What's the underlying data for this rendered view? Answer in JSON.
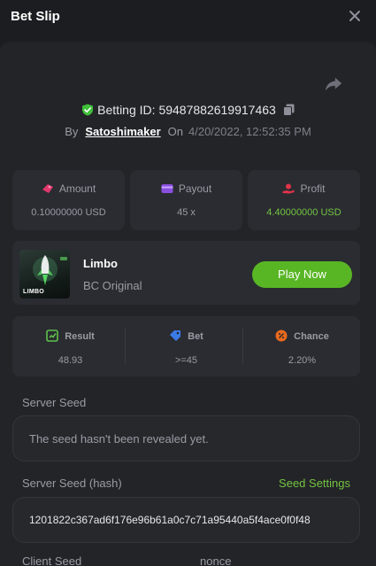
{
  "header": {
    "title": "Bet Slip"
  },
  "bet": {
    "id_label": "Betting ID:",
    "id_value": "59487882619917463",
    "by_label": "By",
    "user": "Satoshimaker",
    "on_label": "On",
    "datetime": "4/20/2022, 12:52:35 PM"
  },
  "stats": {
    "amount": {
      "label": "Amount",
      "value": "0.10000000 USD"
    },
    "payout": {
      "label": "Payout",
      "value": "45 x"
    },
    "profit": {
      "label": "Profit",
      "value": "4.40000000 USD"
    }
  },
  "game": {
    "name": "Limbo",
    "subtitle": "BC Original",
    "thumb_text": "LIMBO",
    "play_label": "Play Now"
  },
  "result": {
    "result": {
      "label": "Result",
      "value": "48.93"
    },
    "bet": {
      "label": "Bet",
      "value": ">=45"
    },
    "chance": {
      "label": "Chance",
      "value": "2.20%"
    }
  },
  "seeds": {
    "server_label": "Server Seed",
    "server_value": "The seed hasn't been revealed yet.",
    "hash_label": "Server Seed (hash)",
    "settings_label": "Seed Settings",
    "hash_value": "1201822c367ad6f176e96b61a0c7c71a95440a5f4ace0f0f48",
    "client_label": "Client Seed",
    "nonce_label": "nonce"
  },
  "colors": {
    "accent_green": "#58b625",
    "profit_green": "#74c441",
    "background": "#1c1d20",
    "panel": "#232428",
    "card": "#2a2c31"
  },
  "icons": {
    "close": "close-icon",
    "share": "share-icon",
    "verified": "shield-check-icon",
    "copy": "copy-icon",
    "amount": "coins-icon",
    "payout": "wallet-icon",
    "profit": "hand-coin-icon",
    "result": "chart-check-icon",
    "bet": "tag-icon",
    "chance": "percent-icon"
  }
}
